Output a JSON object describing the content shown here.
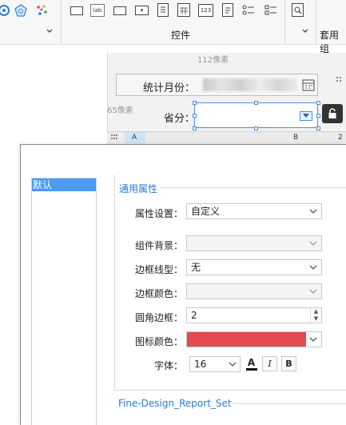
{
  "ribbon": {
    "group_controls_label": "控件",
    "group_template_label": "套用组",
    "icons": [
      "refresh-icon",
      "pentagon-icon",
      "colorful-dots-icon"
    ],
    "controls": [
      {
        "name": "textbox-widget-icon",
        "text": ""
      },
      {
        "name": "label-widget-icon",
        "text": "lab"
      },
      {
        "name": "button-widget-icon",
        "text": ""
      },
      {
        "name": "combobox-widget-icon",
        "text": "▾"
      },
      {
        "name": "tree-combobox-widget-icon",
        "text": ""
      },
      {
        "name": "date-widget-icon",
        "text": ""
      },
      {
        "name": "number-widget-icon",
        "text": "123"
      },
      {
        "name": "textarea-widget-icon",
        "text": ""
      },
      {
        "name": "radio-group-widget-icon",
        "text": ""
      },
      {
        "name": "checkbox-group-widget-icon",
        "text": ""
      },
      {
        "name": "search-report-icon",
        "text": ""
      }
    ]
  },
  "canvas": {
    "ruler_top": "112像素",
    "ruler_left": "65像素",
    "month_label": "统计月份：",
    "province_label": "省分：",
    "grid_col_a": "A",
    "grid_col_b": "B",
    "grid_col_2": "2"
  },
  "dialog": {
    "left_list": {
      "selected": "默认"
    },
    "section_general": "通用属性",
    "fields": {
      "property_setting": {
        "label": "属性设置：",
        "value": "自定义"
      },
      "component_bg": {
        "label": "组件背景：",
        "value": ""
      },
      "border_style": {
        "label": "边框线型：",
        "value": "无"
      },
      "border_color": {
        "label": "边框颜色：",
        "value": ""
      },
      "corner_radius": {
        "label": "圆角边框：",
        "value": "2"
      },
      "icon_color": {
        "label": "图标颜色：",
        "value": "",
        "color": "#e24a52"
      },
      "font": {
        "label": "字体：",
        "size": "16",
        "color_btn": "A",
        "italic_btn": "I",
        "bold_btn": "B"
      }
    },
    "section_design": "Fine-Design_Report_Set"
  },
  "colors": {
    "accent": "#4d9cf1",
    "section_title": "#2d7bd1",
    "icon_color": "#e24a52"
  }
}
